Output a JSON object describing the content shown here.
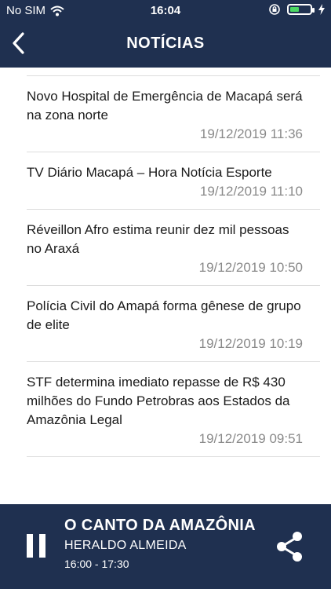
{
  "status_bar": {
    "carrier": "No SIM",
    "time": "16:04"
  },
  "header": {
    "title": "NOTÍCIAS"
  },
  "news": [
    {
      "headline": "Novo Hospital de Emergência de Macapá será na zona norte",
      "date": "19/12/2019 11:36"
    },
    {
      "headline": "TV Diário Macapá – Hora Notícia Esporte",
      "date": "19/12/2019 11:10"
    },
    {
      "headline": "Réveillon Afro estima reunir dez mil pessoas no Araxá",
      "date": "19/12/2019 10:50"
    },
    {
      "headline": "Polícia Civil do Amapá forma gênese de grupo de elite",
      "date": "19/12/2019 10:19"
    },
    {
      "headline": "STF determina imediato repasse de R$ 430 milhões do Fundo Petrobras aos Estados da Amazônia Legal",
      "date": "19/12/2019 09:51"
    }
  ],
  "player": {
    "show": "O CANTO DA AMAZÔNIA",
    "host": "HERALDO ALMEIDA",
    "hours": "16:00 - 17:30"
  },
  "colors": {
    "bar": "#1f3050",
    "date": "#8a8a8a",
    "battery": "#4cd964"
  },
  "icons": [
    "wifi-icon",
    "orientation-lock-icon",
    "battery-icon",
    "charging-icon",
    "back-chevron-icon",
    "pause-icon",
    "share-icon"
  ]
}
